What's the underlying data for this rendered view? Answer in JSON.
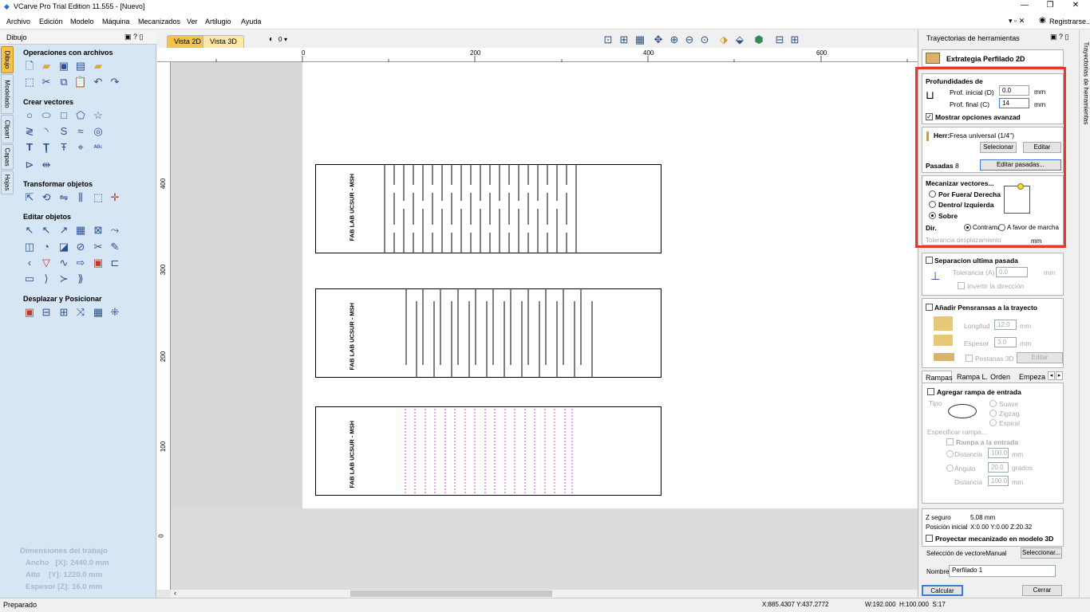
{
  "app": {
    "title": "VCarve Pro Trial Edition 11.555 - [Nuevo]",
    "register": "Registrarse..."
  },
  "menu": [
    "Archivo",
    "Edición",
    "Modelo",
    "Máquina",
    "Mecanizados",
    "Ver",
    "Artilugio",
    "Ayuda"
  ],
  "left_panel": {
    "title": "Dibujo",
    "vtabs": [
      "Dibujo",
      "Modelado",
      "Clipart",
      "Capas",
      "Hojas"
    ],
    "sections": {
      "files": "Operaciones con archivos",
      "create": "Crear vectores",
      "transform": "Transformar objetos",
      "edit": "Editar objetos",
      "move": "Desplazar y Posicionar"
    },
    "job": {
      "title": "Dimensiones del trabajo",
      "width": "Ancho   [X]: 2440.0 mm",
      "height": "Alto    [Y]: 1220.0 mm",
      "thickness": "Espesor [Z]: 16.0 mm"
    }
  },
  "view": {
    "tab2d": "Vista 2D",
    "tab3d": "Vista 3D",
    "layer": "0",
    "ruler_top": [
      "0",
      "200",
      "400",
      "600"
    ],
    "ruler_left": [
      "400",
      "300",
      "200",
      "100",
      "0"
    ],
    "part_label": "FAB LAB UCSUR - MSH"
  },
  "right_panel": {
    "title": "Trayectorias de herramientas",
    "vtab": "Trayectorias de herramientas",
    "strategy": "Extrategia Perfilado 2D",
    "depths": {
      "heading": "Profundidades de",
      "start_label": "Prof. inicial (D)",
      "start_val": "0.0",
      "end_label": "Prof. final (C)",
      "end_val": "14",
      "unit": "mm",
      "advanced": "Mostrar opciones avanzad"
    },
    "tool": {
      "label": "Herr:",
      "name": "Fresa universal (1/4\")",
      "select": "Selecionar",
      "edit": "Editar",
      "passes_label": "Pasadas",
      "passes_val": "8",
      "edit_passes": "Editar pasadas..."
    },
    "machine": {
      "heading": "Mecanizar vectores...",
      "outside": "Por Fuera/ Derecha",
      "inside": "Dentro/ Izquierda",
      "on": "Sobre",
      "dir": "Dir.",
      "conv": "Contrama",
      "climb": "A favor de marcha",
      "tol": "Tolerancia desplazamiento",
      "tol_unit": "mm"
    },
    "sep": {
      "title": "Separacion ultima pasada",
      "tol_label": "Tolerancia (A)",
      "tol_val": "0.0",
      "unit": "mm",
      "invert": "Invertir la dirección"
    },
    "tabs": {
      "title": "Añadir Pensransas a la trayecto",
      "len_label": "Longitud",
      "len_val": "12.0",
      "thk_label": "Espesor",
      "thk_val": "3.0",
      "unit": "mm",
      "tabs3d": "Pestanas 3D",
      "edit": "Editar Pestanas..."
    },
    "ramps_tabs": [
      "Rampas",
      "Rampa L.",
      "Orden",
      "Empeza"
    ],
    "ramps": {
      "add": "Agregar rampa de entrada",
      "type": "Tipo",
      "smooth": "Suave",
      "zigzag": "Zigzag",
      "spiral": "Espiral",
      "specify": "Especificar rampa...",
      "ramp_entry": "Rampa a la entrada",
      "dist_label": "Distancia",
      "dist_val": "100.0",
      "angle_label": "Ángulo",
      "angle_val": "20.0",
      "deg": "grados",
      "dist2_label": "Distancia",
      "dist2_val": "100.0",
      "unit": "mm"
    },
    "safe": {
      "z_label": "Z seguro",
      "z_val": "5.08 mm",
      "home_label": "Posición inicial",
      "home_val": "X:0.00 Y:0.00 Z:20.32",
      "project": "Proyectar mecanizado en modelo 3D"
    },
    "vecsel": {
      "label": "Selección de vectoreManual",
      "btn": "Seleccionar..."
    },
    "name": {
      "label": "Nombre:",
      "val": "Perfilado 1"
    },
    "calc": "Calcular",
    "close": "Cerrar"
  },
  "status": {
    "left": "Preparado",
    "coords": "X:885.4307 Y:437.2772",
    "wh": "W:192.000  H:100.000  S:17"
  },
  "colors": {
    "highlight": "#e8372b",
    "vtab_active": "#f5c24a",
    "panel_bg": "#d6e6f5",
    "toolpath": "#e040e0"
  }
}
